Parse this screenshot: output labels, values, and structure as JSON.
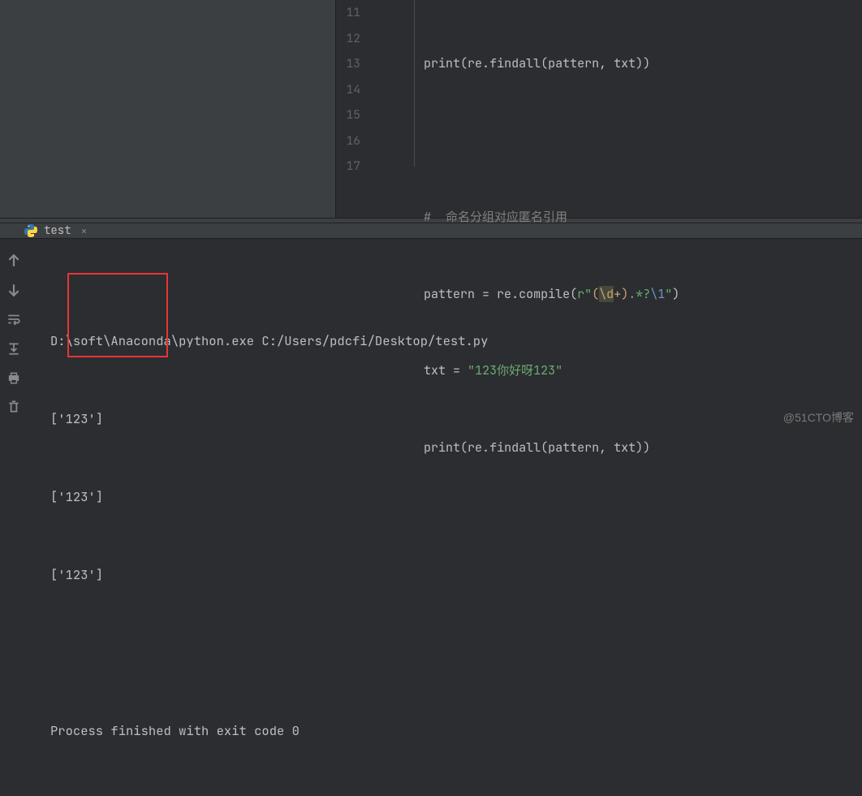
{
  "editor": {
    "gutter": [
      "11",
      "12",
      "13",
      "14",
      "15",
      "16",
      "17"
    ],
    "lines": {
      "l11": {
        "print": "print",
        "open": "(",
        "re": "re",
        "dot": ".",
        "findall": "findall",
        "open2": "(",
        "p": "pattern",
        "comma": ", ",
        "t": "txt",
        "close": "))"
      },
      "l13_comment": "#  命名分组对应匿名引用",
      "l14": {
        "lhs": "pattern ",
        "eq": "=",
        "sp": " ",
        "re": "re",
        "dot": ".",
        "compile": "compile",
        "open": "(",
        "rpre": "r",
        "q": "\"",
        "g1": "(",
        "d": "\\d",
        "plus": "+",
        "g2": ")",
        "rest": ".*?",
        "ref": "\\1",
        "q2": "\"",
        "close": ")"
      },
      "l15": {
        "lhs": "txt ",
        "eq": "=",
        "sp": " ",
        "q": "\"",
        "val": "123你好呀123",
        "q2": "\""
      },
      "l16": {
        "print": "print",
        "open": "(",
        "re": "re",
        "dot": ".",
        "findall": "findall",
        "open2": "(",
        "p": "pattern",
        "comma": ", ",
        "t": "txt",
        "close": "))"
      }
    }
  },
  "run": {
    "tab_label": "test",
    "console": {
      "cmd": "D:\\soft\\Anaconda\\python.exe C:/Users/pdcfi/Desktop/test.py",
      "out1": "['123']",
      "out2": "['123']",
      "out3": "['123']",
      "exit": "Process finished with exit code 0"
    }
  },
  "watermark": "@51CTO博客"
}
